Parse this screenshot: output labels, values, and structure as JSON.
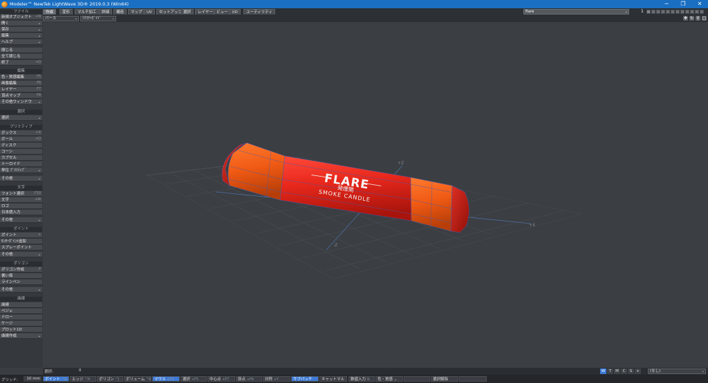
{
  "window": {
    "title": "Modeler™ NewTek LightWave 3D® 2019.0.3 (Win64)",
    "min_glyph": "─",
    "max_glyph": "❐",
    "close_glyph": "✕"
  },
  "tabs": [
    "作成",
    "変形",
    "マルチ加工",
    "詳細",
    "構造",
    "マップ",
    "UV",
    "セットアップ",
    "選択",
    "レイヤー",
    "ビュー",
    "I/O",
    "ユーティリティ"
  ],
  "layers": {
    "name": "flare",
    "number": "1"
  },
  "viewport": {
    "view": "パース",
    "shading": "ﾃｸｽﾁｬｶﾞｲﾄﾞ"
  },
  "sections": {
    "file": "ファイル",
    "edit": "編集",
    "select": "選択",
    "primitive": "プリミティブ",
    "text": "文字",
    "point": "ポイント",
    "polygon": "ポリゴン",
    "curve": "曲線"
  },
  "toolbar": {
    "file": [
      {
        "label": "新規オブジェクト",
        "shortcut": "+N"
      },
      {
        "label": "開く",
        "chev": "⌄"
      },
      {
        "label": "保存",
        "chev": "⌄"
      },
      {
        "label": "編集",
        "chev": "⌄"
      },
      {
        "label": "ヘルプ",
        "chev": "⌄"
      },
      {
        "label": "閉じる"
      },
      {
        "label": "全て閉じる"
      },
      {
        "label": "終了",
        "shortcut": "+Q"
      }
    ],
    "edit": [
      {
        "label": "色・質感編集",
        "shortcut": "F5"
      },
      {
        "label": "画像編集",
        "shortcut": "F6"
      },
      {
        "label": "レイヤー",
        "shortcut": "F7"
      },
      {
        "label": "頂点マップ",
        "shortcut": "F8"
      },
      {
        "label": "その他ウィンドウ",
        "chev": "⌄"
      }
    ],
    "select": [
      {
        "label": "選択",
        "chev": "⌄"
      }
    ],
    "primitive": [
      {
        "label": "ボックス",
        "shortcut": "+X"
      },
      {
        "label": "ボール",
        "shortcut": "+O"
      },
      {
        "label": "ディスク"
      },
      {
        "label": "コーン"
      },
      {
        "label": "カプセル"
      },
      {
        "label": "トーロイド"
      },
      {
        "label": "単位 ﾌﾟﾘﾐﾃｨﾌﾞ",
        "chev": "⌄"
      },
      {
        "label": "その他",
        "chev": "⌄"
      }
    ],
    "text": [
      {
        "label": "フォント選択",
        "shortcut": "F10"
      },
      {
        "label": "文字",
        "shortcut": "+W"
      },
      {
        "label": "ロゴ"
      },
      {
        "label": "日本語入力"
      },
      {
        "label": "その他",
        "chev": "⌄"
      }
    ],
    "point": [
      {
        "label": "ポイント",
        "shortcut": "+"
      },
      {
        "label": "ｾﾝﾀｰﾎﾟｲﾝﾄ追加"
      },
      {
        "label": "スプレーポイント"
      },
      {
        "label": "その他",
        "chev": "⌄"
      }
    ],
    "polygon": [
      {
        "label": "ポリゴン作成",
        "shortcut": "P"
      },
      {
        "label": "書い面"
      },
      {
        "label": "ラインペン"
      },
      {
        "label": "その他",
        "chev": "⌄"
      }
    ],
    "curve": [
      {
        "label": "曲線"
      },
      {
        "label": "ベジェ"
      },
      {
        "label": "ドロー"
      },
      {
        "label": "ケージ"
      },
      {
        "label": "プロット1D"
      },
      {
        "label": "曲線作成",
        "chev": "⌄"
      }
    ]
  },
  "model": {
    "label_main": "FLARE",
    "label_jp": "発煙筒",
    "label_sub": "SMOKE  CANDLE",
    "axis_x": "+X",
    "axis_neg_x": "-X",
    "axis_z": "+Z",
    "axis_neg_z": "-Z",
    "body_color": "#e8281c",
    "cap_color": "#f05a14"
  },
  "status": {
    "selected_label": "選択:",
    "selected_count": "0",
    "wtmcs": [
      "W",
      "T",
      "M",
      "C",
      "S",
      "+"
    ],
    "none_option": "(なし)"
  },
  "bottom": {
    "grid_label": "グリッド:",
    "grid_value": "10 mm",
    "buttons": [
      {
        "label": "ポイント",
        "shortcut": "^G",
        "on": true
      },
      {
        "label": "エッジ",
        "shortcut": "^H"
      },
      {
        "label": "ポリゴン",
        "shortcut": "^J"
      },
      {
        "label": "ボリューム",
        "shortcut": "^K"
      },
      {
        "label": "マウス",
        "shortcut": "+F3",
        "on": true
      },
      {
        "label": "選択",
        "shortcut": "+F5"
      },
      {
        "label": "中心点",
        "shortcut": "+F7"
      },
      {
        "label": "原点",
        "shortcut": "+F6"
      },
      {
        "label": "対称",
        "shortcut": "+Y"
      },
      {
        "label": "サブパッチ",
        "shortcut": "",
        "on": true
      },
      {
        "label": "キャットマル",
        "chev": "⌄"
      },
      {
        "label": "数値入力",
        "shortcut": "N"
      },
      {
        "label": "色・質感",
        "chev": "⌄"
      },
      {
        "label": "",
        "chev": ""
      },
      {
        "label": "選択解除",
        "shortcut": ""
      },
      {
        "label": "",
        "chev": ""
      }
    ]
  }
}
